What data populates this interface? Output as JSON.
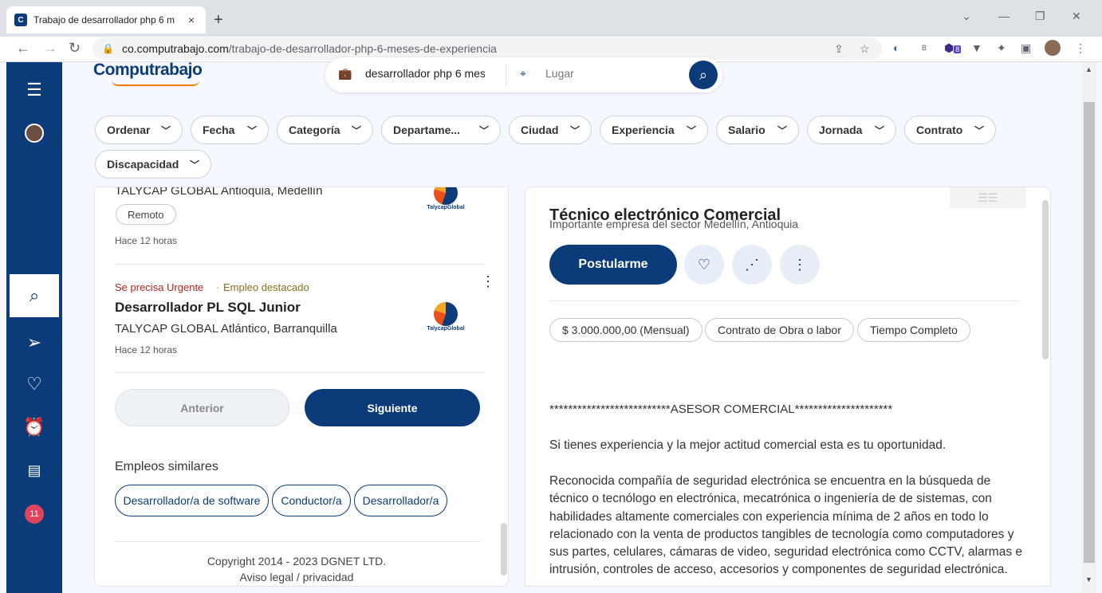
{
  "browser": {
    "tab_title": "Trabajo de desarrollador php 6 m",
    "tab_close": "×",
    "new_tab": "+",
    "url_host": "co.computrabajo.com",
    "url_path": "/trabajo-de-desarrollador-php-6-meses-de-experiencia",
    "ext_badge": "8"
  },
  "header": {
    "logo": "Computrabajo",
    "search_value": "desarrollador php 6 mes",
    "location_placeholder": "Lugar"
  },
  "sidebar": {
    "notification_count": "11"
  },
  "filters": [
    "Ordenar",
    "Fecha",
    "Categoría",
    "Departame...",
    "Ciudad",
    "Experiencia",
    "Salario",
    "Jornada",
    "Contrato",
    "Discapacidad"
  ],
  "job_list": {
    "job1": {
      "company": "TALYCAP GLOBAL Antioquia, Medellín",
      "tag": "Remoto",
      "time": "Hace 12 horas"
    },
    "job2": {
      "urgent": "Se precisa Urgente",
      "separator": "·",
      "featured": "Empleo destacado",
      "title": "Desarrollador PL SQL Junior",
      "company": "TALYCAP GLOBAL Atlántico, Barranquilla",
      "time": "Hace 12 horas"
    },
    "company_logo_text": "TalycapGlobal",
    "prev_label": "Anterior",
    "next_label": "Siguiente",
    "similar_heading": "Empleos similares",
    "similar": [
      "Desarrollador/a de software",
      "Conductor/a",
      "Desarrollador/a"
    ],
    "copyright": "Copyright 2014 - 2023 DGNET LTD.",
    "legal": "Aviso legal / privacidad"
  },
  "job_detail": {
    "title": "Técnico electrónico Comercial",
    "subtitle": "Importante empresa del sector Medellín, Antioquia",
    "apply_label": "Postularme",
    "tags": [
      "$ 3.000.000,00 (Mensual)",
      "Contrato de Obra o labor",
      "Tiempo Completo"
    ],
    "heading_line": "**************************ASESOR COMERCIAL*********************",
    "para1": "Si tienes experiencia y la mejor actitud comercial esta es tu oportunidad.",
    "para2": "Reconocida compañía de seguridad electrónica se encuentra en la búsqueda de técnico o tecnólogo en electrónica, mecatrónica o ingeniería de de sistemas, con habilidades altamente comerciales con experiencia mínima de 2 años en todo lo relacionado con la venta de productos tangibles de tecnología como computadores y sus partes, celulares, cámaras de video, seguridad electrónica como CCTV, alarmas e intrusión, controles de acceso, accesorios y componentes de seguridad electrónica."
  },
  "colors": {
    "brand_blue": "#0b3b78",
    "urgent_red": "#b3261e",
    "badge_red": "#e0435c",
    "logo_orange": "#ef7d00"
  }
}
